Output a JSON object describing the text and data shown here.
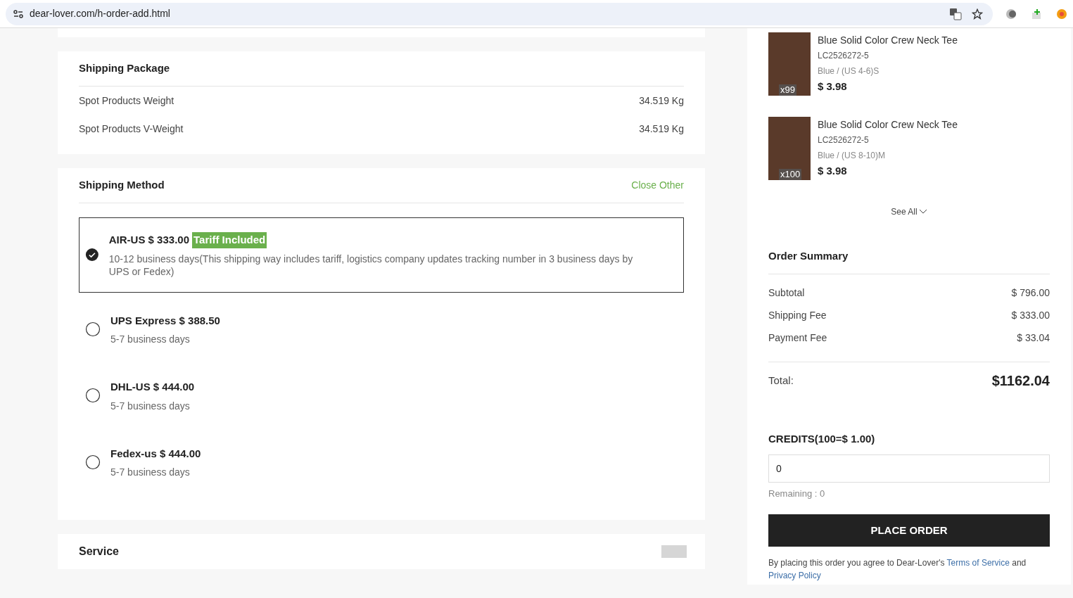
{
  "browser": {
    "url": "dear-lover.com/h-order-add.html"
  },
  "package": {
    "title": "Shipping Package",
    "rows": [
      {
        "label": "Spot Products Weight",
        "value": "34.519 Kg"
      },
      {
        "label": "Spot Products V-Weight",
        "value": "34.519 Kg"
      }
    ]
  },
  "shipping": {
    "title": "Shipping Method",
    "action": "Close Other",
    "methods": [
      {
        "name": "AIR-US $ 333.00",
        "badge": "Tariff Included",
        "detail": "10-12 business days(This shipping way includes tariff, logistics company updates tracking number in 3 business days by UPS or Fedex)",
        "selected": true
      },
      {
        "name": "UPS Express $ 388.50",
        "detail": "5-7 business days",
        "selected": false
      },
      {
        "name": "DHL-US $ 444.00",
        "detail": "5-7 business days",
        "selected": false
      },
      {
        "name": "Fedex-us $ 444.00",
        "detail": "5-7 business days",
        "selected": false
      }
    ]
  },
  "service": {
    "title": "Service"
  },
  "items": [
    {
      "name": "Blue Solid Color Crew Neck Tee",
      "sku": "LC2526272-5",
      "variant": "Blue / (US 4-6)S",
      "price": "$ 3.98",
      "qty": "x99"
    },
    {
      "name": "Blue Solid Color Crew Neck Tee",
      "sku": "LC2526272-5",
      "variant": "Blue / (US 8-10)M",
      "price": "$ 3.98",
      "qty": "x100"
    }
  ],
  "see_all": "See All",
  "summary": {
    "title": "Order Summary",
    "rows": [
      {
        "label": "Subtotal",
        "value": "$ 796.00"
      },
      {
        "label": "Shipping Fee",
        "value": "$ 333.00"
      },
      {
        "label": "Payment Fee",
        "value": "$ 33.04"
      }
    ],
    "total_label": "Total:",
    "total": "$1162.04"
  },
  "credits": {
    "title": "CREDITS(100=$ 1.00)",
    "value": "0",
    "remaining": "Remaining : 0"
  },
  "place_order": "PLACE ORDER",
  "terms": [
    {
      "kind": "text",
      "text": "By placing this order you agree to Dear-Lover's "
    },
    {
      "kind": "link",
      "text": "Terms of Service"
    },
    {
      "kind": "text",
      "text": " and "
    },
    {
      "kind": "link",
      "text": "Privacy Policy"
    }
  ]
}
